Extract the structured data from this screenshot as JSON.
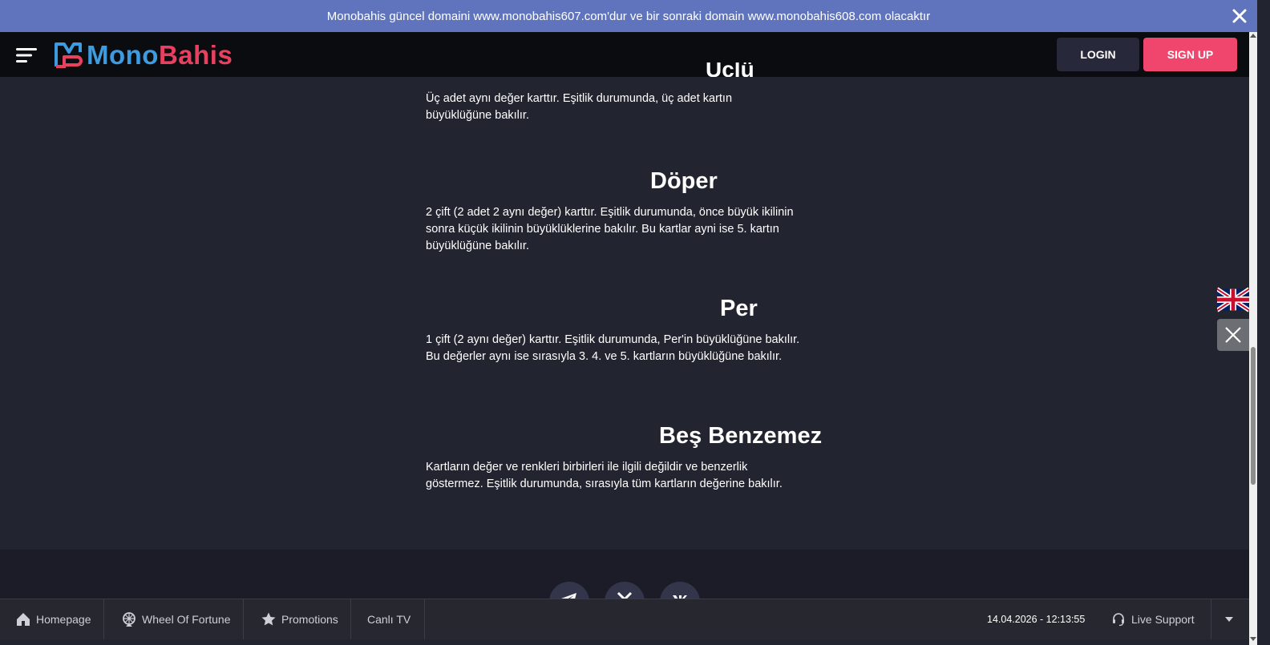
{
  "announcement": {
    "text": "Monobahis güncel domaini www.monobahis607.com'dur ve bir sonraki domain www.monobahis608.com olacaktır"
  },
  "header": {
    "logo_part1": "Mono",
    "logo_part2": "Bahis",
    "login_label": "LOGIN",
    "signup_label": "SIGN UP"
  },
  "colors": {
    "announcement_bg": "#5f74bd",
    "brand_blue": "#3d9be0",
    "brand_pink": "#e8405f",
    "signup_bg": "#f0456c",
    "page_bg": "#22242f"
  },
  "content": {
    "partial_heading": "Üçlü",
    "sections": [
      {
        "title": "",
        "text": "Üç adet aynı değer karttır. Eşitlik durumunda, üç adet kartın büyüklüğüne bakılır."
      },
      {
        "title": "Döper",
        "text": "2 çift (2 adet 2 aynı değer) karttır. Eşitlik durumunda, önce büyük ikilinin sonra küçük ikilinin büyüklüklerine bakılır. Bu kartlar ayni ise 5. kartın büyüklüğüne bakılır."
      },
      {
        "title": "Per",
        "text": "1 çift (2 aynı değer) karttır. Eşitlik durumunda, Per'in büyüklüğüne bakılır. Bu değerler aynı ise sırasıyla 3. 4. ve 5. kartların büyüklüğüne bakılır."
      },
      {
        "title": "Beş Benzemez",
        "text": "Kartların değer ve renkleri birbirleri ile ilgili değildir ve benzerlik göstermez. Eşitlik durumunda, sırasıyla tüm kartların değerine bakılır."
      }
    ]
  },
  "bottom_nav": {
    "items": [
      {
        "label": "Homepage",
        "icon": "home-icon"
      },
      {
        "label": "Wheel Of Fortune",
        "icon": "wheel-icon"
      },
      {
        "label": "Promotions",
        "icon": "star-icon"
      },
      {
        "label": "Canlı TV",
        "icon": ""
      }
    ],
    "datetime": "14.04.2026 - 12:13:55",
    "live_support": "Live Support"
  },
  "icons": {
    "social": [
      "telegram-icon",
      "x-icon",
      "vk-icon"
    ],
    "language_flag": "uk-flag-icon"
  }
}
